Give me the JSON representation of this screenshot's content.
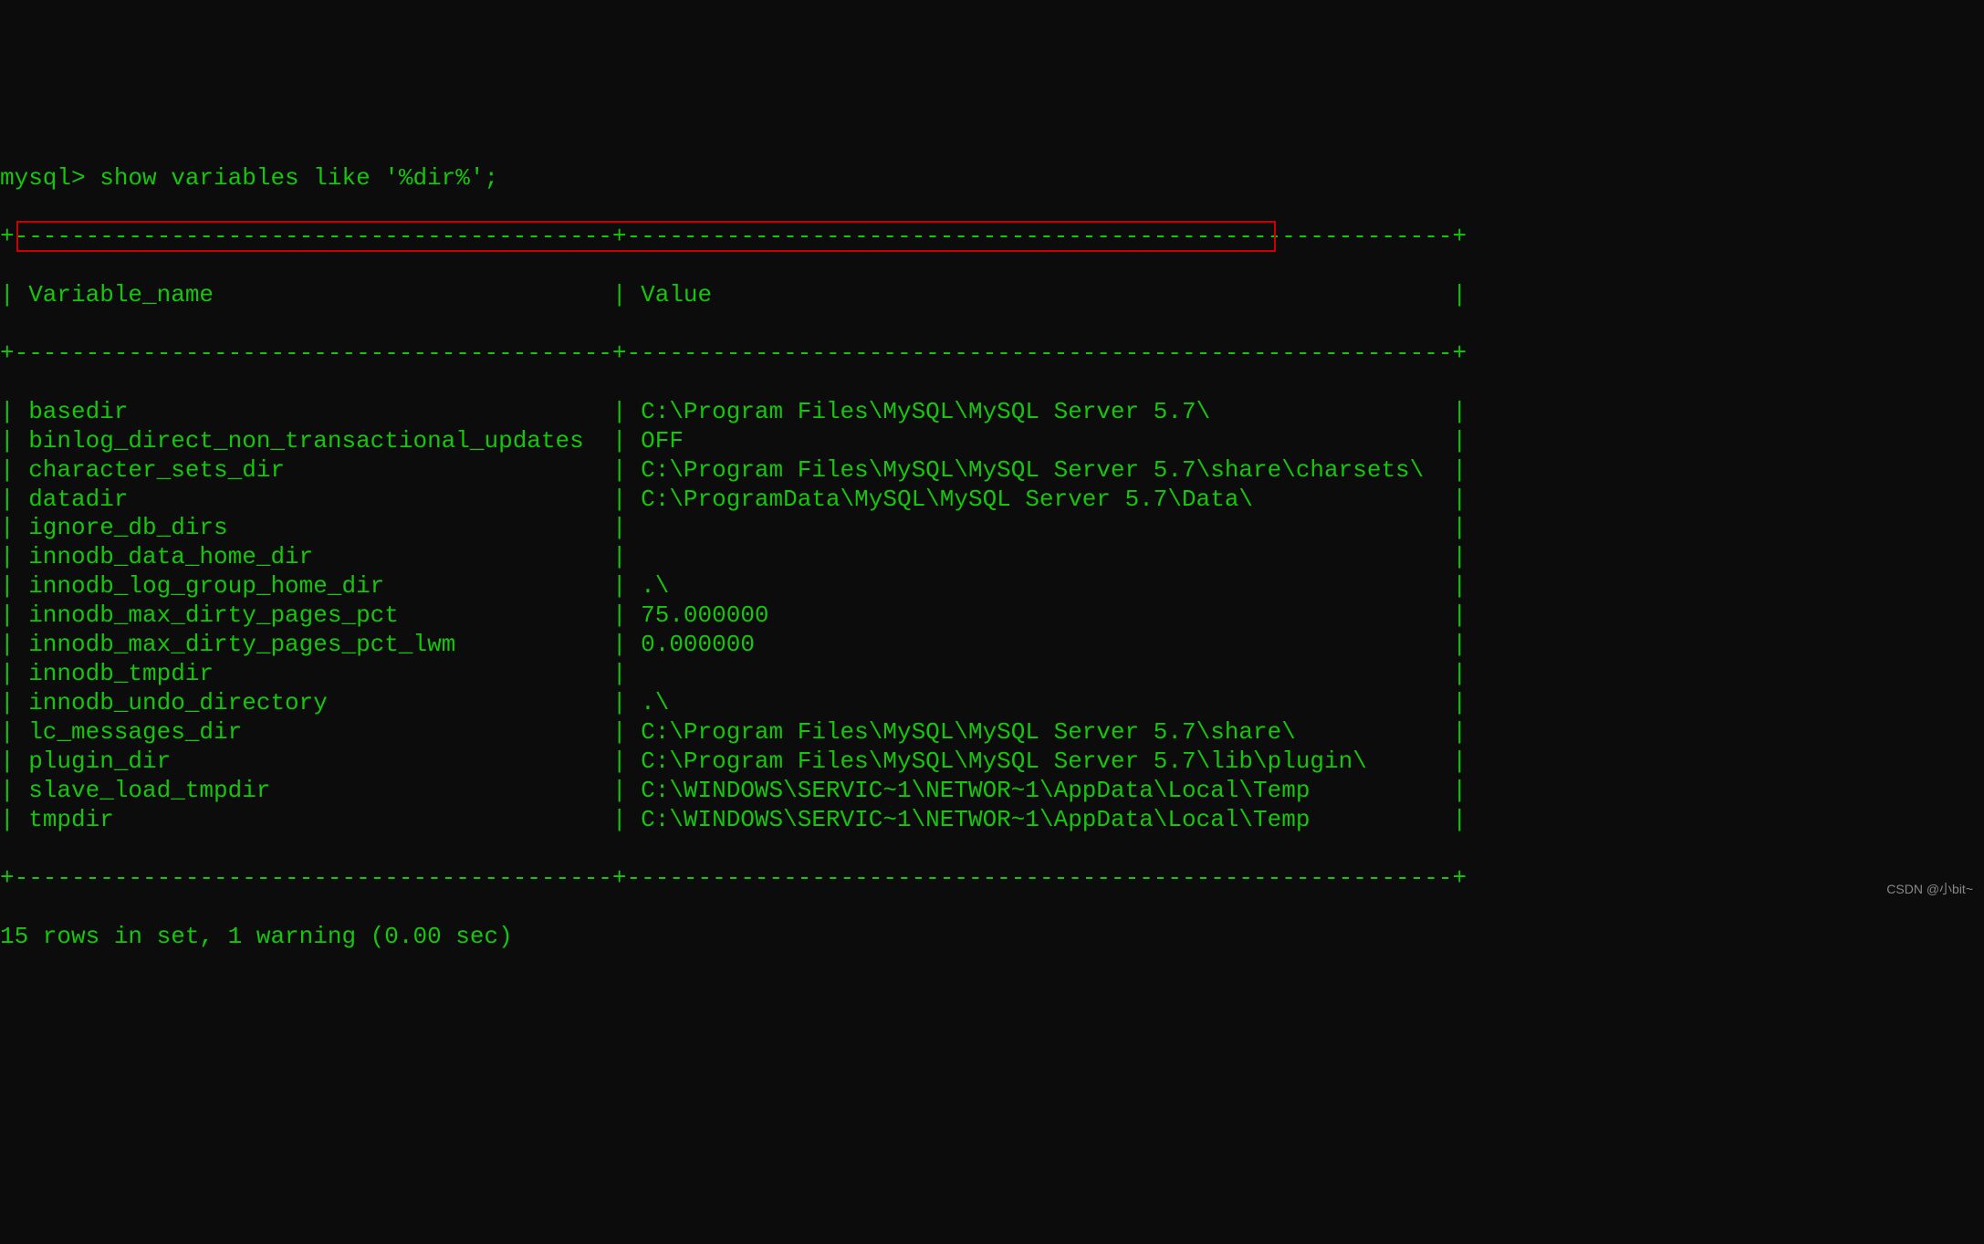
{
  "prompt": "mysql> show variables like '%dir%';",
  "border_top": "+------------------------------------------+----------------------------------------------------------+",
  "header_line": "| Variable_name                            | Value                                                    |",
  "border_mid": "+------------------------------------------+----------------------------------------------------------+",
  "rows": [
    {
      "name": "basedir",
      "value": "C:\\Program Files\\MySQL\\MySQL Server 5.7\\"
    },
    {
      "name": "binlog_direct_non_transactional_updates",
      "value": "OFF"
    },
    {
      "name": "character_sets_dir",
      "value": "C:\\Program Files\\MySQL\\MySQL Server 5.7\\share\\charsets\\"
    },
    {
      "name": "datadir",
      "value": "C:\\ProgramData\\MySQL\\MySQL Server 5.7\\Data\\"
    },
    {
      "name": "ignore_db_dirs",
      "value": ""
    },
    {
      "name": "innodb_data_home_dir",
      "value": ""
    },
    {
      "name": "innodb_log_group_home_dir",
      "value": ".\\"
    },
    {
      "name": "innodb_max_dirty_pages_pct",
      "value": "75.000000"
    },
    {
      "name": "innodb_max_dirty_pages_pct_lwm",
      "value": "0.000000"
    },
    {
      "name": "innodb_tmpdir",
      "value": ""
    },
    {
      "name": "innodb_undo_directory",
      "value": ".\\"
    },
    {
      "name": "lc_messages_dir",
      "value": "C:\\Program Files\\MySQL\\MySQL Server 5.7\\share\\"
    },
    {
      "name": "plugin_dir",
      "value": "C:\\Program Files\\MySQL\\MySQL Server 5.7\\lib\\plugin\\"
    },
    {
      "name": "slave_load_tmpdir",
      "value": "C:\\WINDOWS\\SERVIC~1\\NETWOR~1\\AppData\\Local\\Temp"
    },
    {
      "name": "tmpdir",
      "value": "C:\\WINDOWS\\SERVIC~1\\NETWOR~1\\AppData\\Local\\Temp"
    }
  ],
  "border_bot": "+------------------------------------------+----------------------------------------------------------+",
  "footer": "15 rows in set, 1 warning (0.00 sec)",
  "columns": {
    "name_header": "Variable_name",
    "value_header": "Value",
    "col1_width": 40,
    "col2_width": 56
  },
  "highlight_row_index": 3,
  "watermark": "CSDN @小bit~"
}
